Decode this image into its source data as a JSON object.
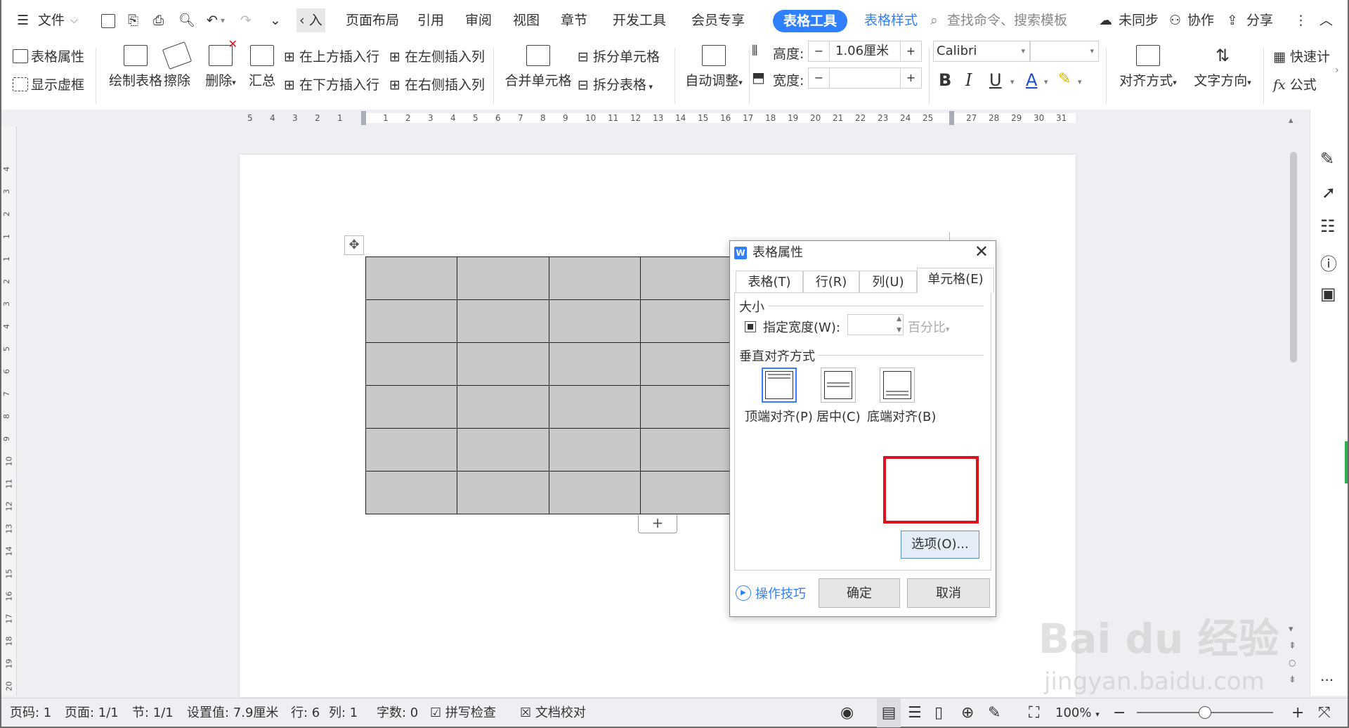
{
  "menubar": {
    "file_label": "文件",
    "tabs": [
      "‹ 入",
      "页面布局",
      "引用",
      "审阅",
      "视图",
      "章节",
      "开发工具",
      "会员专享"
    ],
    "active_tab": "表格工具",
    "style_tab": "表格样式",
    "search_placeholder": "查找命令、搜索模板",
    "sync": "未同步",
    "collab": "协作",
    "share": "分享"
  },
  "ribbon": {
    "table_props": "表格属性",
    "show_grid": "显示虚框",
    "draw_table": "绘制表格",
    "erase": "擦除",
    "delete": "删除",
    "summary": "汇总",
    "insert_above": "在上方插入行",
    "insert_below": "在下方插入行",
    "insert_left": "在左侧插入列",
    "insert_right": "在右侧插入列",
    "merge_cells": "合并单元格",
    "split_cells": "拆分单元格",
    "split_table": "拆分表格",
    "auto_fit": "自动调整",
    "height_label": "高度:",
    "height_value": "1.06厘米",
    "width_label": "宽度:",
    "width_value": "",
    "minus": "−",
    "plus": "+",
    "font_name": "Calibri",
    "font_size": "",
    "bold": "B",
    "italic": "I",
    "underline": "U",
    "font_color": "A",
    "align": "对齐方式",
    "text_dir": "文字方向",
    "quick_calc": "快速计",
    "formula": "公式"
  },
  "hruler_ticks": [
    "5",
    "4",
    "3",
    "2",
    "1",
    "1",
    "2",
    "3",
    "4",
    "5",
    "6",
    "7",
    "8",
    "9",
    "10",
    "11",
    "12",
    "13",
    "14",
    "15",
    "16",
    "17",
    "18",
    "19",
    "20",
    "21",
    "22",
    "23",
    "24",
    "25",
    "27",
    "28",
    "29",
    "30",
    "31"
  ],
  "vruler_ticks": [
    "4",
    "3",
    "2",
    "1",
    "1",
    "2",
    "3",
    "4",
    "5",
    "6",
    "7",
    "8",
    "9",
    "10",
    "11",
    "12",
    "13",
    "14",
    "15",
    "16",
    "17",
    "18",
    "19",
    "20"
  ],
  "table": {
    "rows": 6,
    "cols": 4
  },
  "dialog": {
    "title": "表格属性",
    "tabs": [
      "表格(T)",
      "行(R)",
      "列(U)",
      "单元格(E)"
    ],
    "active_tab_index": 3,
    "size_section": "大小",
    "specify_width": "指定宽度(W):",
    "width_value": "",
    "width_unit": "百分比",
    "valign_section": "垂直对齐方式",
    "valign_options": [
      "顶端对齐(P)",
      "居中(C)",
      "底端对齐(B)"
    ],
    "options_button": "选项(O)...",
    "tips": "操作技巧",
    "ok": "确定",
    "cancel": "取消"
  },
  "watermark": {
    "brand": "Bai du 经验",
    "url": "jingyan.baidu.com"
  },
  "status": {
    "page_no": "页码: 1",
    "page": "页面: 1/1",
    "section": "节: 1/1",
    "setting": "设置值: 7.9厘米",
    "row": "行: 6",
    "col": "列: 1",
    "words": "字数: 0",
    "spell": "拼写检查",
    "proof": "文档校对",
    "zoom": "100%",
    "zoom_fraction": 0.5
  },
  "colors": {
    "accent": "#2f7fff",
    "highlight_box": "#e0101a",
    "cell_fill": "#c8c8c8"
  }
}
